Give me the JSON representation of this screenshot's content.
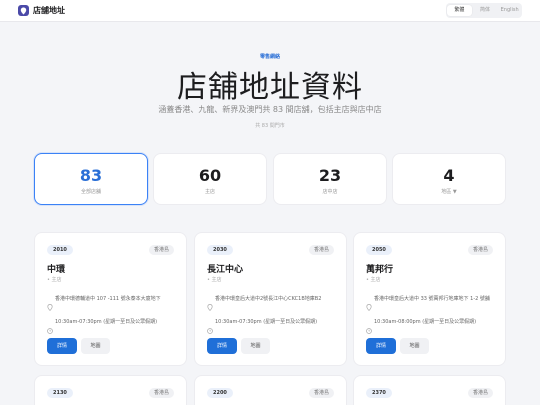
{
  "header": {
    "brand": "店舖地址",
    "languages": [
      "繁體",
      "简体",
      "English"
    ],
    "active_language": 0
  },
  "hero": {
    "eyebrow": "零售網絡",
    "title": "店舖地址資料",
    "subtitle": "涵蓋香港、九龍、新界及澳門共 83 間店舖，包括主店與店中店",
    "count_line": "共 83 間門市"
  },
  "stats": [
    {
      "num": "83",
      "label": "全部店舖"
    },
    {
      "num": "60",
      "label": "主店"
    },
    {
      "num": "23",
      "label": "店中店"
    },
    {
      "num": "4",
      "label": "地區 ▼"
    }
  ],
  "stores": [
    {
      "code": "2010",
      "region": "香港島",
      "name": "中環",
      "kind": "主店",
      "address": "香港中環德輔道中 107 -111 號永泰本大廈地下",
      "hours": "10:30am-07:30pm (星期一至日及公眾假期)",
      "primary": "詳情",
      "map": "地圖"
    },
    {
      "code": "2030",
      "region": "香港島",
      "name": "長江中心",
      "kind": "主店",
      "address": "香港中環皇后大道中2號長江中心CKC1B地庫B2",
      "hours": "10:30am-07:30pm (星期一至日及公眾假期)",
      "primary": "詳情",
      "map": "地圖"
    },
    {
      "code": "2050",
      "region": "香港島",
      "name": "萬邦行",
      "kind": "主店",
      "address": "香港中環皇后大道中 33 號萬邦行地庫地下 1-2 號舖",
      "hours": "10:30am-08:00pm (星期一至日及公眾假期)",
      "primary": "詳情",
      "map": "地圖"
    },
    {
      "code": "2130",
      "region": "香港島"
    },
    {
      "code": "2200",
      "region": "香港島"
    },
    {
      "code": "2370",
      "region": "香港島"
    }
  ]
}
